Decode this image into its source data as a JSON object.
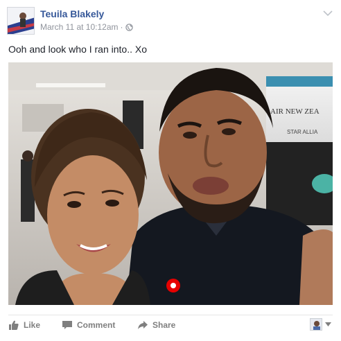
{
  "post": {
    "author": "Teuila Blakely",
    "timestamp": "March 11 at 10:12am",
    "separator": "·",
    "audience_icon": "globe-icon",
    "text": "Ooh and look who I ran into.. Xo"
  },
  "photo": {
    "sign_text_1": "AIR NEW ZEA",
    "sign_text_2": "STAR ALLIA"
  },
  "actions": {
    "like_label": "Like",
    "comment_label": "Comment",
    "share_label": "Share"
  },
  "colors": {
    "author_link": "#365899",
    "meta_text": "#90949c",
    "action_text": "#7f7f7f",
    "divider": "#e5e5e5"
  }
}
